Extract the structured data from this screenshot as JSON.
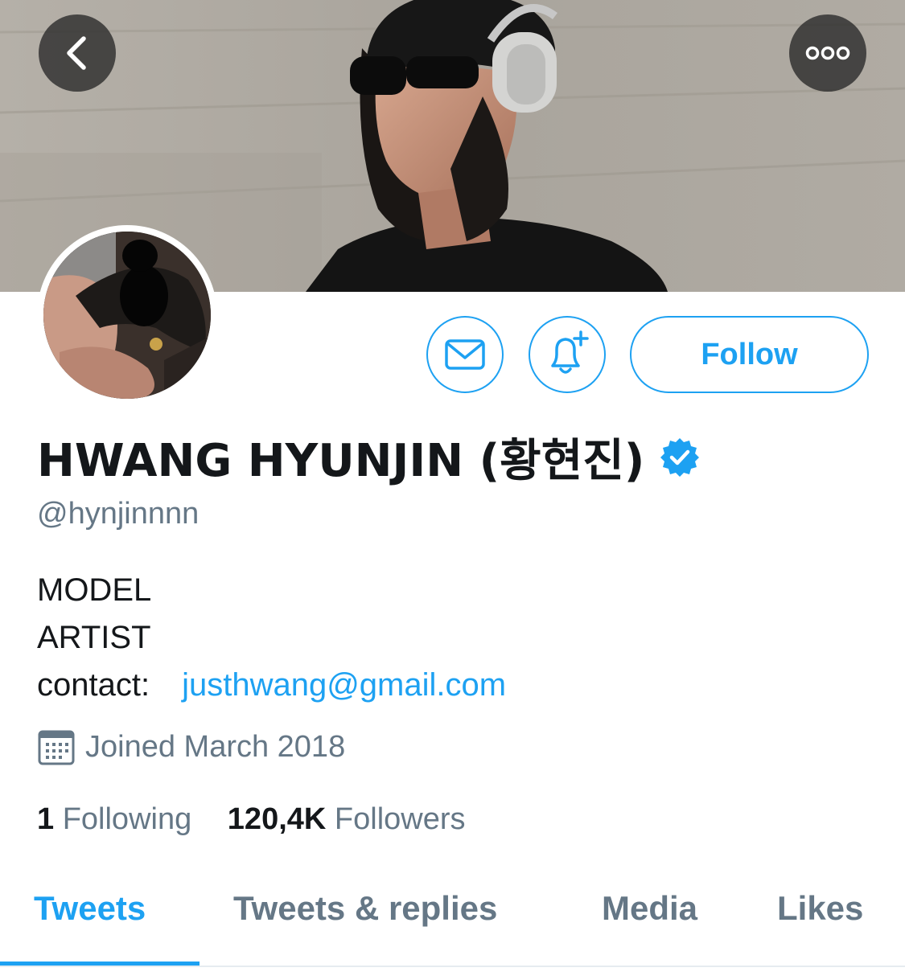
{
  "profile": {
    "display_name": "HWANG HYUNJIN (황현진)",
    "handle": "@hynjinnnn",
    "bio_lines": [
      "MODEL",
      "ARTIST"
    ],
    "contact_label": "contact:",
    "contact_email": "justhwang@gmail.com",
    "joined": "Joined March 2018",
    "verified": true
  },
  "stats": {
    "following_count": "1",
    "following_label": "Following",
    "followers_count": "120,4K",
    "followers_label": "Followers"
  },
  "actions": {
    "follow_label": "Follow"
  },
  "tabs": [
    {
      "label": "Tweets",
      "active": true
    },
    {
      "label": "Tweets & replies",
      "active": false
    },
    {
      "label": "Media",
      "active": false
    },
    {
      "label": "Likes",
      "active": false
    }
  ],
  "colors": {
    "accent": "#1da1f2",
    "text_primary": "#14171a",
    "text_secondary": "#657786"
  },
  "icons": {
    "back": "chevron-left-icon",
    "more": "more-horizontal-icon",
    "message": "envelope-icon",
    "notifications": "bell-plus-icon",
    "verified": "verified-badge-icon",
    "joined": "calendar-icon"
  }
}
